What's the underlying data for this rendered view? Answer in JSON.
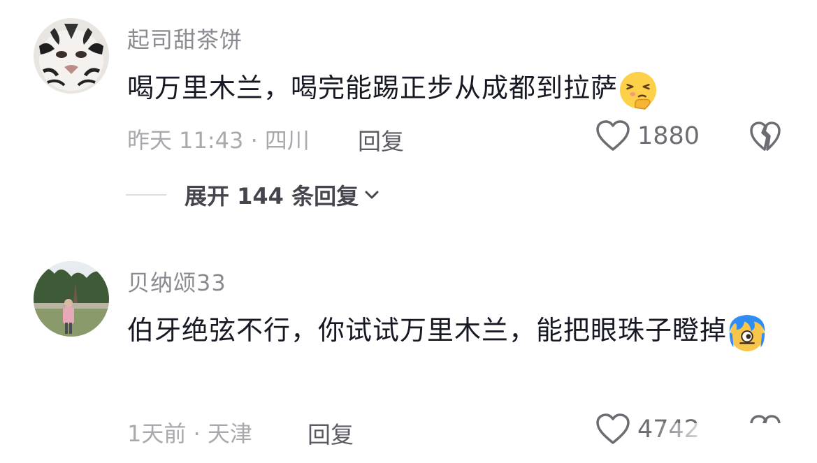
{
  "comments": [
    {
      "username": "起司甜茶饼",
      "text": "喝万里木兰，喝完能踢正步从成都到拉萨",
      "emoji": "shushing-face-emoji",
      "time_location": "昨天 11:43 · 四川",
      "reply_label": "回复",
      "likes": "1880",
      "expand_label": "展开 144 条回复"
    },
    {
      "username": "贝纳颂33",
      "text": "伯牙绝弦不行，你试试万里木兰，能把眼珠子瞪掉",
      "emoji": "blue-hair-staring-face-emoji",
      "time_location": "1天前 · 天津",
      "reply_label": "回复",
      "likes": "4742"
    }
  ],
  "colors": {
    "text": "#161823",
    "username": "#8a8b91",
    "meta": "#a8a9ad",
    "action": "#5b5c63"
  }
}
